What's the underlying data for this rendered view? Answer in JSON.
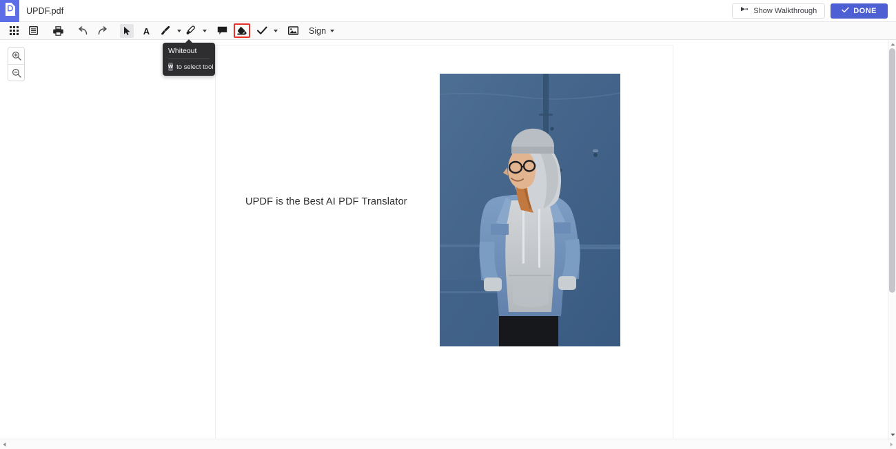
{
  "titlebar": {
    "app_logo_icon": "updf-document-logo",
    "document_name": "UPDF.pdf",
    "walkthrough_button": "Show Walkthrough",
    "walkthrough_icon": "play-pointer-icon",
    "done_button": "DONE",
    "done_icon": "check-icon",
    "brand_color": "#5b6ee8",
    "done_button_color": "#4e5fd4"
  },
  "toolbar": {
    "items": [
      {
        "name": "page-thumbnails",
        "icon": "grid-icon",
        "label": "",
        "has_caret": false
      },
      {
        "name": "page-view",
        "icon": "list-page-icon",
        "label": "",
        "has_caret": false
      },
      {
        "name": "print",
        "icon": "printer-icon",
        "label": "",
        "has_caret": false
      },
      {
        "name": "undo",
        "icon": "undo-arrow-icon",
        "label": "",
        "has_caret": false
      },
      {
        "name": "redo",
        "icon": "redo-arrow-icon",
        "label": "",
        "has_caret": false
      },
      {
        "name": "select",
        "icon": "cursor-arrow-icon",
        "label": "",
        "has_caret": false
      },
      {
        "name": "text",
        "icon": "text-a-icon",
        "label": "",
        "has_caret": false
      },
      {
        "name": "brush",
        "icon": "brush-pen-icon",
        "label": "",
        "has_caret": true
      },
      {
        "name": "highlighter",
        "icon": "highlighter-pen-icon",
        "label": "",
        "has_caret": true
      },
      {
        "name": "comment",
        "icon": "comment-bubble-icon",
        "label": "",
        "has_caret": false
      },
      {
        "name": "whiteout",
        "icon": "whiteout-ink-drop-icon",
        "label": "",
        "has_caret": false
      },
      {
        "name": "checkmark",
        "icon": "check-mark-icon",
        "label": "",
        "has_caret": true
      },
      {
        "name": "image",
        "icon": "image-picture-icon",
        "label": "",
        "has_caret": false
      },
      {
        "name": "sign",
        "icon": "",
        "label": "Sign",
        "has_caret": true
      }
    ],
    "active_tool": "select",
    "highlighted_tool": "whiteout",
    "highlight_color": "#e8302a"
  },
  "tooltip": {
    "title": "Whiteout",
    "shortcut_key": "W",
    "hint": "to select tool",
    "background": "#2e2e30"
  },
  "zoom_controls": {
    "zoom_in_icon": "magnifier-plus-icon",
    "zoom_out_icon": "magnifier-minus-icon"
  },
  "document": {
    "body_text": "UPDF is the Best AI PDF Translator",
    "image_alt": "woman-in-denim-jacket-against-blue-wall-photo",
    "page_background": "#ffffff"
  },
  "scrollbars": {
    "vertical_up_icon": "caret-up-icon",
    "vertical_down_icon": "caret-down-icon",
    "horizontal_left_icon": "caret-left-icon",
    "horizontal_right_icon": "caret-right-icon"
  }
}
